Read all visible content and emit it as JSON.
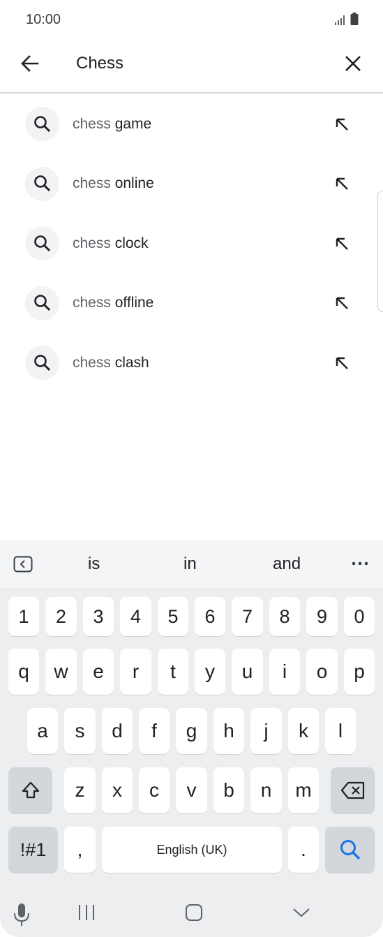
{
  "status_bar": {
    "time": "10:00",
    "signal_icon": "signal-icon",
    "battery_icon": "battery-icon"
  },
  "search": {
    "query": "Chess",
    "back_icon": "arrow-left-icon",
    "clear_icon": "close-icon"
  },
  "suggestions": [
    {
      "prefix": "chess ",
      "rest": "game"
    },
    {
      "prefix": "chess ",
      "rest": "online"
    },
    {
      "prefix": "chess ",
      "rest": "clock"
    },
    {
      "prefix": "chess ",
      "rest": "offline"
    },
    {
      "prefix": "chess ",
      "rest": "clash"
    }
  ],
  "keyboard": {
    "predictions": [
      "is",
      "in",
      "and"
    ],
    "number_row": [
      "1",
      "2",
      "3",
      "4",
      "5",
      "6",
      "7",
      "8",
      "9",
      "0"
    ],
    "row1": [
      "q",
      "w",
      "e",
      "r",
      "t",
      "y",
      "u",
      "i",
      "o",
      "p"
    ],
    "row2": [
      "a",
      "s",
      "d",
      "f",
      "g",
      "h",
      "j",
      "k",
      "l"
    ],
    "row3": [
      "z",
      "x",
      "c",
      "v",
      "b",
      "n",
      "m"
    ],
    "symbols_label": "!#1",
    "comma_label": ",",
    "space_label": "English (UK)",
    "period_label": ".",
    "colors": {
      "accent": "#1a73e8",
      "key_bg": "#ffffff",
      "key_dark_bg": "#d3d6da",
      "keyboard_bg": "#eceef0"
    }
  },
  "navbar": {
    "mic_icon": "microphone-icon",
    "recents_icon": "recents-icon",
    "home_icon": "home-icon",
    "hide_keyboard_icon": "chevron-down-icon"
  }
}
